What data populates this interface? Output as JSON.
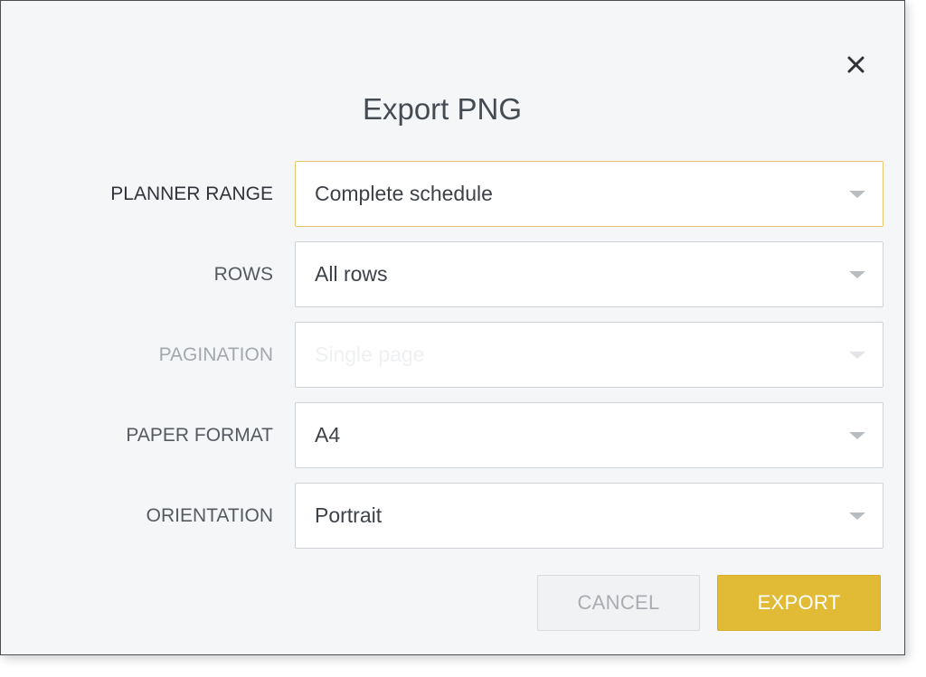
{
  "dialog": {
    "title": "Export PNG",
    "close_icon": "close-icon"
  },
  "fields": [
    {
      "label": "PLANNER RANGE",
      "value": "Complete schedule",
      "state": "focused"
    },
    {
      "label": "ROWS",
      "value": "All rows",
      "state": "normal"
    },
    {
      "label": "PAGINATION",
      "value": "Single page",
      "state": "disabled"
    },
    {
      "label": "PAPER FORMAT",
      "value": "A4",
      "state": "normal"
    },
    {
      "label": "ORIENTATION",
      "value": "Portrait",
      "state": "normal"
    }
  ],
  "buttons": {
    "cancel_label": "CANCEL",
    "export_label": "EXPORT"
  },
  "colors": {
    "accent": "#e1ba36",
    "focus_border": "#e6c66a",
    "background": "#f5f6f8"
  }
}
